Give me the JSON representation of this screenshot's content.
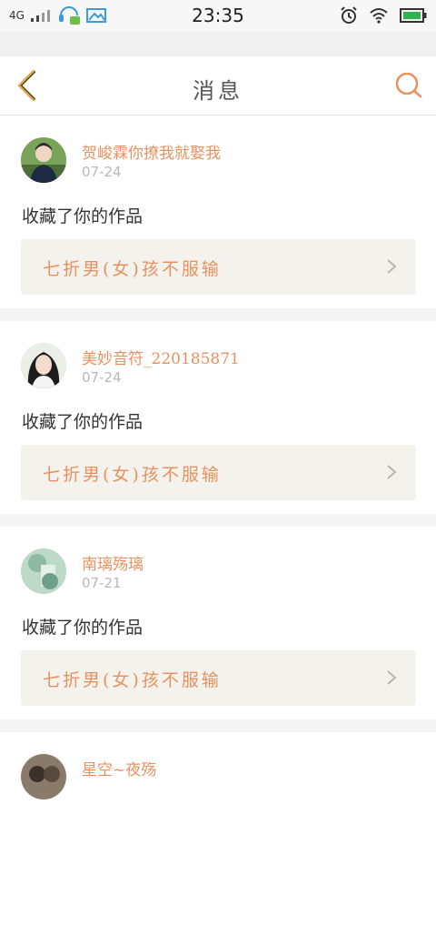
{
  "status_bar": {
    "network": "4G",
    "time": "23:35"
  },
  "nav": {
    "title": "消息"
  },
  "colors": {
    "accent": "#e8915f",
    "back_icon": "#e0a94a"
  },
  "notifications": [
    {
      "username": "贺峻霖你撩我就娶我",
      "date": "07-24",
      "action": "收藏了你的作品",
      "work_title": "七折男(女)孩不服输"
    },
    {
      "username": "美妙音符_220185871",
      "date": "07-24",
      "action": "收藏了你的作品",
      "work_title": "七折男(女)孩不服输"
    },
    {
      "username": "南璃殇璃",
      "date": "07-21",
      "action": "收藏了你的作品",
      "work_title": "七折男(女)孩不服输"
    },
    {
      "username": "星空~夜殇"
    }
  ]
}
